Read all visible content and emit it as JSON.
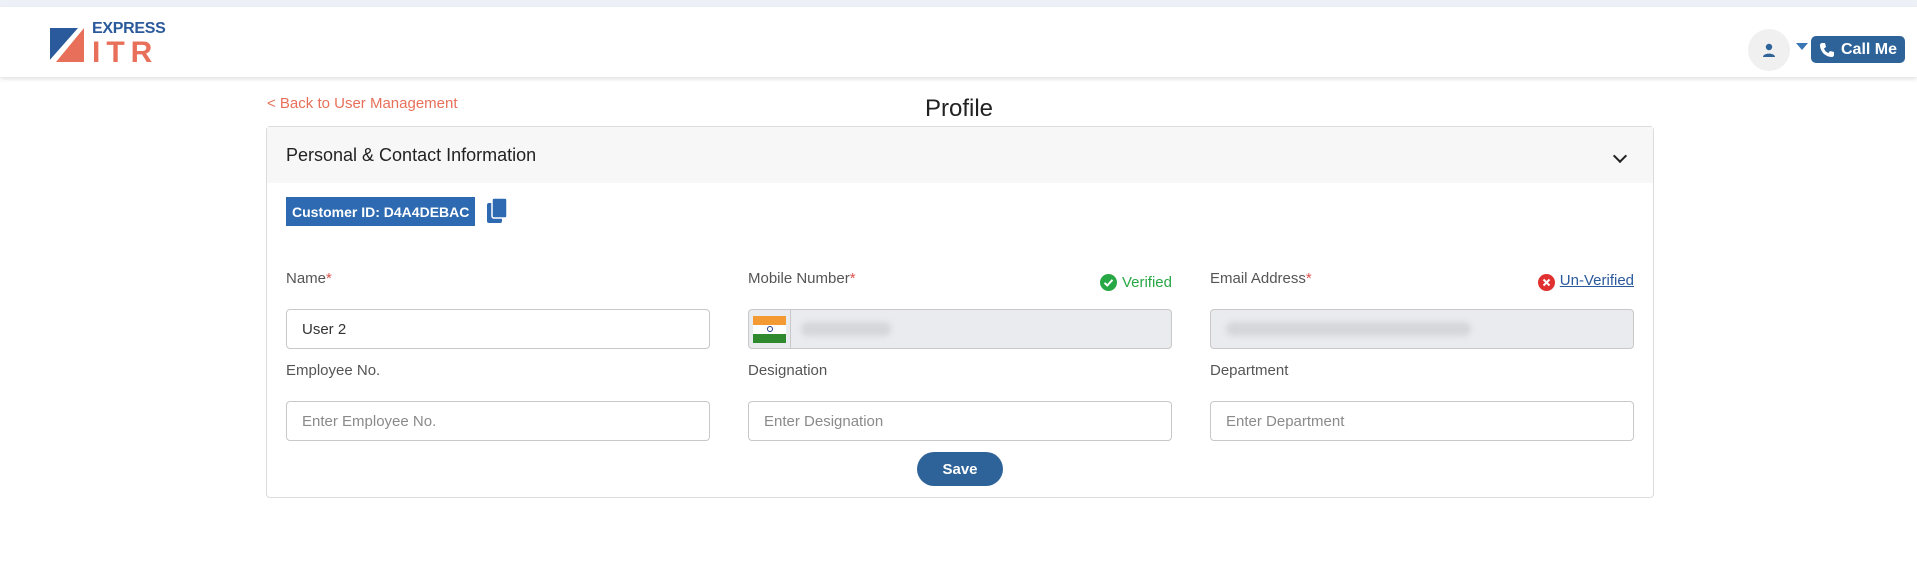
{
  "brand": {
    "logo_line1": "EXPRESS",
    "logo_line2": "ITR"
  },
  "header": {
    "call_label": "Call Me"
  },
  "nav": {
    "back_label": "< Back to User Management"
  },
  "page": {
    "title": "Profile"
  },
  "section": {
    "title": "Personal & Contact Information",
    "customer_id": "Customer ID: D4A4DEBAC"
  },
  "form": {
    "name": {
      "label": "Name",
      "required": "*",
      "value": "User 2"
    },
    "mobile": {
      "label": "Mobile Number",
      "required": "*",
      "status": "Verified"
    },
    "email": {
      "label": "Email Address",
      "required": "*",
      "status": "Un-Verified"
    },
    "employee": {
      "label": "Employee No.",
      "placeholder": "Enter Employee No."
    },
    "designation": {
      "label": "Designation",
      "placeholder": "Enter Designation"
    },
    "department": {
      "label": "Department",
      "placeholder": "Enter Department"
    },
    "save_label": "Save"
  },
  "colors": {
    "accent": "#2d6398",
    "link": "#e8705a",
    "verified": "#28a745",
    "error": "#e0302f"
  },
  "icons": [
    "user-icon",
    "phone-icon",
    "chevron-down-icon",
    "copy-icon",
    "check-circle-icon",
    "x-circle-icon",
    "india-flag-icon"
  ]
}
